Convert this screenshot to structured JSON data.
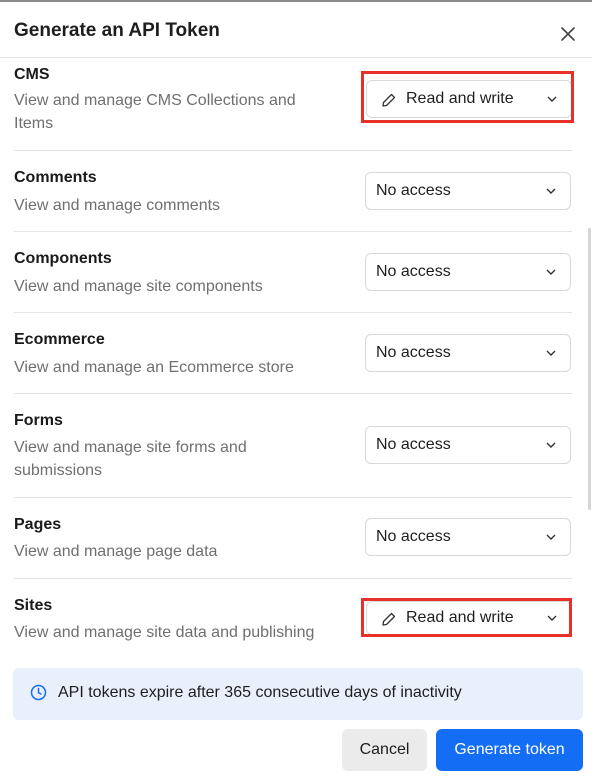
{
  "dialog": {
    "title": "Generate an API Token",
    "close_icon": "close-icon"
  },
  "scopes": [
    {
      "key": "cms",
      "title": "CMS",
      "description": "View and manage CMS Collections and Items",
      "access": "Read and write",
      "highlighted": true
    },
    {
      "key": "comments",
      "title": "Comments",
      "description": "View and manage comments",
      "access": "No access",
      "highlighted": false
    },
    {
      "key": "components",
      "title": "Components",
      "description": "View and manage site components",
      "access": "No access",
      "highlighted": false
    },
    {
      "key": "ecommerce",
      "title": "Ecommerce",
      "description": "View and manage an Ecommerce store",
      "access": "No access",
      "highlighted": false
    },
    {
      "key": "forms",
      "title": "Forms",
      "description": "View and manage site forms and submissions",
      "access": "No access",
      "highlighted": false
    },
    {
      "key": "pages",
      "title": "Pages",
      "description": "View and manage page data",
      "access": "No access",
      "highlighted": false
    },
    {
      "key": "sites",
      "title": "Sites",
      "description": "View and manage site data and publishing",
      "access": "Read and write",
      "highlighted": true
    }
  ],
  "notice": {
    "icon": "clock-icon",
    "text": "API tokens expire after 365 consecutive days of inactivity"
  },
  "footer": {
    "cancel_label": "Cancel",
    "generate_label": "Generate token"
  },
  "colors": {
    "primary": "#146ef5",
    "highlight": "#e8302a",
    "notice_bg": "#e9effb"
  }
}
